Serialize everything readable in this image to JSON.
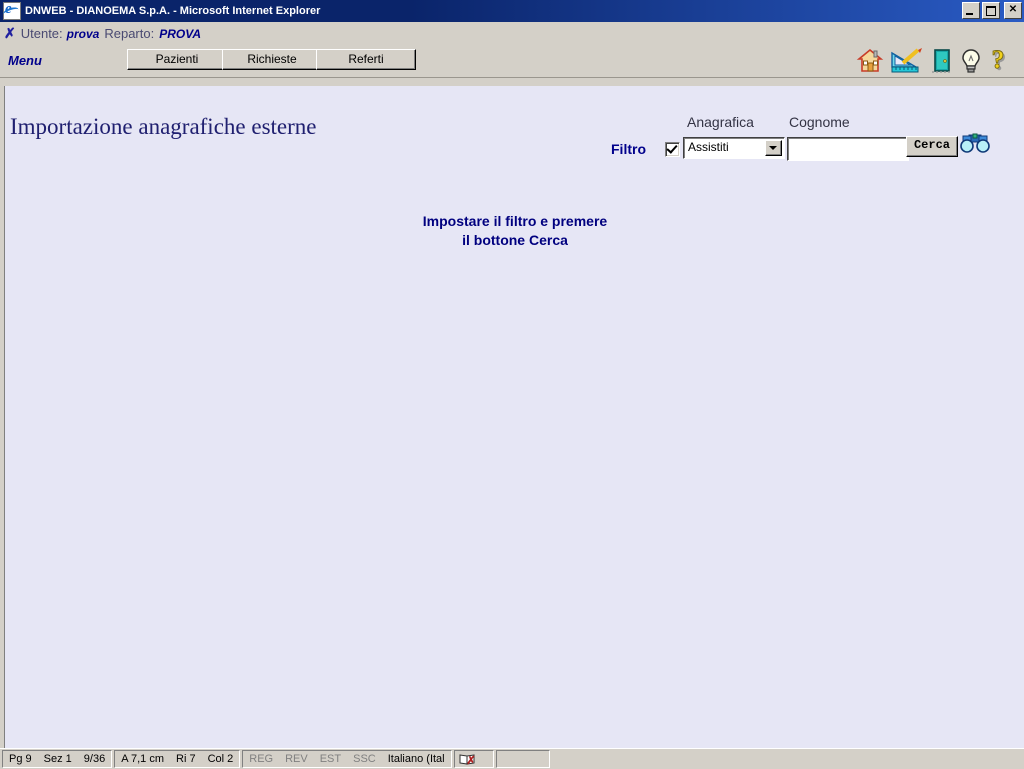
{
  "window": {
    "title": "DNWEB - DIANOEMA S.p.A. - Microsoft Internet Explorer",
    "app_icon": "internet-explorer-icon",
    "minimize_label": "_",
    "maximize_label": "□",
    "close_label": "✕"
  },
  "userbar": {
    "close_mark": "✗",
    "user_label": "Utente:",
    "user_value": "prova",
    "dept_label": "Reparto:",
    "dept_value": "PROVA"
  },
  "menu": {
    "label": "Menu",
    "buttons": [
      {
        "label": "Pazienti"
      },
      {
        "label": "Richieste"
      },
      {
        "label": "Referti"
      }
    ],
    "icons": [
      {
        "name": "home-icon",
        "title": "Home"
      },
      {
        "name": "drafting-ruler-pencil-icon",
        "title": "Strumenti"
      },
      {
        "name": "exit-door-icon",
        "title": "Esci"
      },
      {
        "name": "lightbulb-icon",
        "title": "Suggerimenti"
      },
      {
        "name": "question-mark-help-icon",
        "title": "Guida"
      }
    ]
  },
  "page": {
    "title": "Importazione anagrafiche esterne",
    "message_line1": "Impostare il filtro e premere",
    "message_line2": "il bottone Cerca"
  },
  "filter": {
    "filtro_label": "Filtro",
    "checkbox_checked": true,
    "anagrafica_label": "Anagrafica",
    "anagrafica_value": "Assistiti",
    "anagrafica_options": [
      "Assistiti"
    ],
    "cognome_label": "Cognome",
    "cognome_value": "",
    "cognome_placeholder": "",
    "search_button_label": "Cerca",
    "binoculars_icon": "binoculars-icon"
  },
  "statusbar": {
    "page": "Pg  9",
    "section": "Sez  1",
    "page_of": "9/36",
    "at": "A 7,1 cm",
    "line": "Ri  7",
    "column": "Col  2",
    "reg": "REG",
    "rev": "REV",
    "est": "EST",
    "ssc": "SSC",
    "language": "Italiano (Ital",
    "spellcheck_icon": "book-with-red-x-icon"
  },
  "colors": {
    "titlebar": "#0a246a",
    "chrome": "#d4d0c8",
    "content_bg": "#e6e6f5",
    "accent_text": "#00008b",
    "title_text": "#202070"
  }
}
